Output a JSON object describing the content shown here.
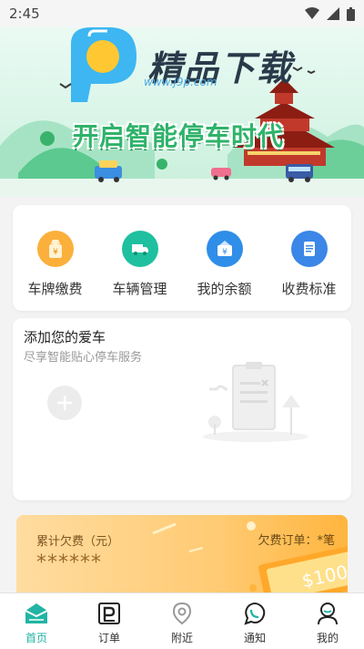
{
  "status_bar": {
    "time": "2:45"
  },
  "banner": {
    "brand": "精品下载",
    "url": "www.j9p.com",
    "slogan": "开启智能停车时代"
  },
  "menu": {
    "items": [
      {
        "label": "车牌缴费",
        "icon": "yen-bag-icon",
        "color": "#f8a52a"
      },
      {
        "label": "车辆管理",
        "icon": "truck-icon",
        "color": "#1ec0a0"
      },
      {
        "label": "我的余额",
        "icon": "wallet-icon",
        "color": "#2f8ee8"
      },
      {
        "label": "收费标准",
        "icon": "document-icon",
        "color": "#3b86e6"
      }
    ]
  },
  "car_card": {
    "title": "添加您的爱车",
    "subtitle": "尽享智能贴心停车服务"
  },
  "arrears": {
    "label": "累计欠费（元）",
    "value": "******",
    "orders": "欠费订单：*笔",
    "coupon_text": "$100"
  },
  "tabbar": {
    "items": [
      {
        "label": "首页",
        "icon": "home-icon",
        "active": true
      },
      {
        "label": "订单",
        "icon": "order-icon",
        "active": false
      },
      {
        "label": "附近",
        "icon": "location-icon",
        "active": false
      },
      {
        "label": "通知",
        "icon": "notification-icon",
        "active": false
      },
      {
        "label": "我的",
        "icon": "user-icon",
        "active": false
      }
    ]
  },
  "colors": {
    "accent": "#22b4a4",
    "banner_green": "#2fb36a"
  }
}
